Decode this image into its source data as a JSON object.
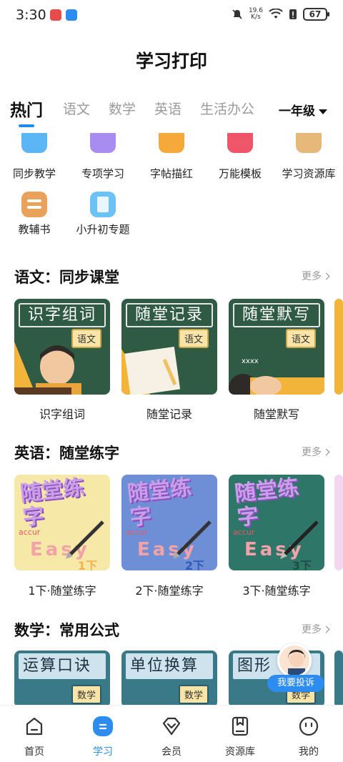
{
  "status_bar": {
    "time": "3:30",
    "speed_value": "19.6",
    "speed_unit": "K/s",
    "battery": "67"
  },
  "header": {
    "title": "学习打印"
  },
  "tabs": {
    "items": [
      "热门",
      "语文",
      "数学",
      "英语",
      "生活办公"
    ],
    "active": "热门",
    "grade": "一年级"
  },
  "quick_grid": {
    "row1": [
      "同步教学",
      "专项学习",
      "字帖描红",
      "万能模板",
      "学习资源库"
    ],
    "row2": [
      "教辅书",
      "小升初专题"
    ]
  },
  "sections": {
    "chinese": {
      "title": "语文：同步课堂",
      "more": "更多",
      "cards": [
        {
          "cover_title": "识字组词",
          "tag": "语文",
          "label": "识字组词"
        },
        {
          "cover_title": "随堂记录",
          "tag": "语文",
          "label": "随堂记录"
        },
        {
          "cover_title": "随堂默写",
          "tag": "语文",
          "label": "随堂默写"
        }
      ]
    },
    "english": {
      "title": "英语：随堂练字",
      "more": "更多",
      "cards": [
        {
          "cover_big": "随堂练字",
          "accur": "accur",
          "easy": "Easy",
          "grade": "1下",
          "label": "1下·随堂练字",
          "bg": "#f6e9a8",
          "grade_color": "#f3b24a"
        },
        {
          "cover_big": "随堂练字",
          "accur": "accur",
          "easy": "Easy",
          "grade": "2下",
          "label": "2下·随堂练字",
          "bg": "#6e8fd6",
          "grade_color": "#2f5bb8"
        },
        {
          "cover_big": "随堂练字",
          "accur": "accur",
          "easy": "Easy",
          "grade": "3下",
          "label": "3下·随堂练字",
          "bg": "#2e7668",
          "grade_color": "#1f4f44"
        }
      ]
    },
    "math": {
      "title": "数学：常用公式",
      "more": "更多",
      "cards": [
        {
          "cover_title": "运算口诀",
          "tag": "数学"
        },
        {
          "cover_title": "单位换算",
          "tag": "数学"
        },
        {
          "cover_title": "图形",
          "tag": "数学"
        }
      ]
    }
  },
  "complaint_button": {
    "label": "我要投诉"
  },
  "bottom_nav": {
    "items": [
      "首页",
      "学习",
      "会员",
      "资源库",
      "我的"
    ],
    "active": "学习"
  },
  "colors": {
    "accent": "#2d8cf0",
    "chalkboard": "#2f5b45",
    "math_board": "#3a7a88"
  }
}
